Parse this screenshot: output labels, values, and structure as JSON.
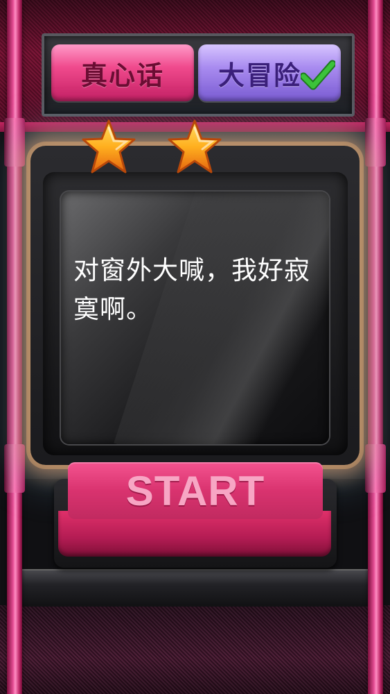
{
  "mode_toggle": {
    "truth_label": "真心话",
    "dare_label": "大冒险",
    "selected": "dare"
  },
  "rating": {
    "stars": 2
  },
  "card": {
    "text": "对窗外大喊，我好寂寞啊。"
  },
  "start_button": {
    "label": "START"
  },
  "colors": {
    "truth": "#f04a8d",
    "dare": "#a98cf0",
    "start": "#d9336f",
    "check": "#3cc23a"
  },
  "icons": [
    "check-icon",
    "star-icon"
  ]
}
